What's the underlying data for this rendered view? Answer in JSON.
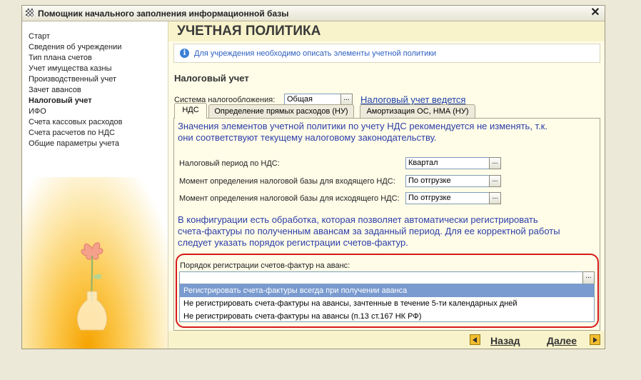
{
  "window": {
    "title": "Помощник начального заполнения информационной базы"
  },
  "sidebar": {
    "items": [
      {
        "label": "Старт"
      },
      {
        "label": "Сведения об учреждении"
      },
      {
        "label": "Тип плана счетов"
      },
      {
        "label": "Учет имущества казны"
      },
      {
        "label": "Производственный учет"
      },
      {
        "label": "Зачет авансов"
      },
      {
        "label": "Налоговый учет"
      },
      {
        "label": "ИФО"
      },
      {
        "label": "Счета кассовых расходов"
      },
      {
        "label": "Счета расчетов по НДС"
      },
      {
        "label": "Общие параметры учета"
      }
    ],
    "active_index": 6
  },
  "page": {
    "title": "УЧЕТНАЯ ПОЛИТИКА",
    "info": "Для учреждения необходимо описать элементы учетной политики",
    "section_title": "Налоговый учет",
    "tax_system_label": "Система налогообложения:",
    "tax_system_value": "Общая",
    "tax_status_link": "Налоговый учет ведется"
  },
  "tabs": [
    {
      "label": "НДС"
    },
    {
      "label": "Определение прямых расходов (НУ)"
    },
    {
      "label": "Амортизация ОС, НМА (НУ)"
    }
  ],
  "vat": {
    "note_line1": "Значения элементов учетной политики по учету НДС рекомендуется не изменять, т.к.",
    "note_line2": "они соответствуют текущему налоговому законодательству.",
    "period_label": "Налоговый период по НДС:",
    "period_value": "Квартал",
    "base_in_label": "Момент определения налоговой базы для входящего НДС:",
    "base_in_value": "По отгрузке",
    "base_out_label": "Момент определения налоговой базы для исходящего НДС:",
    "base_out_value": "По отгрузке",
    "proc_line1": "В конфигурации есть обработка, которая позволяет автоматически регистрировать",
    "proc_line2": "счета-фактуры по полученным авансам за заданный период. Для ее корректной работы",
    "proc_line3": "следует указать порядок регистрации счетов-фактур.",
    "order_label": "Порядок регистрации счетов-фактур на аванс:",
    "order_value": "",
    "order_options": [
      "Регистрировать счета-фактуры всегда при получении аванса",
      "Не регистрировать счета-фактуры на авансы, зачтенные в течение 5-ти календарных дней",
      "Не регистрировать счета-фактуры на авансы (п.13 ст.167 НК РФ)"
    ],
    "order_highlighted": 0
  },
  "buttons": {
    "back": "Назад",
    "next": "Далее",
    "dots": "..."
  },
  "colors": {
    "highlight_ring": "#d51a1a",
    "link": "#1e3faa",
    "note_text": "#2c3ea8",
    "selection": "#7a9bd0"
  }
}
